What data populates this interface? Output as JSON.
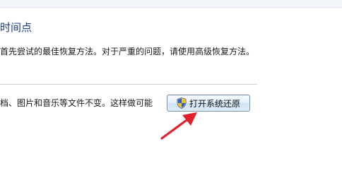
{
  "header": {
    "title": "时间点"
  },
  "main": {
    "description": "首先尝试的最佳恢复方法。对于严重的问题，请使用高级恢复方法。",
    "body_text": "档、图片和音乐等文件不变。这样做可能",
    "restore_button": {
      "label": "打开系统还原",
      "icon": "uac-shield-icon"
    }
  },
  "annotation": {
    "icon": "red-arrow-icon",
    "color": "#e0202a"
  }
}
